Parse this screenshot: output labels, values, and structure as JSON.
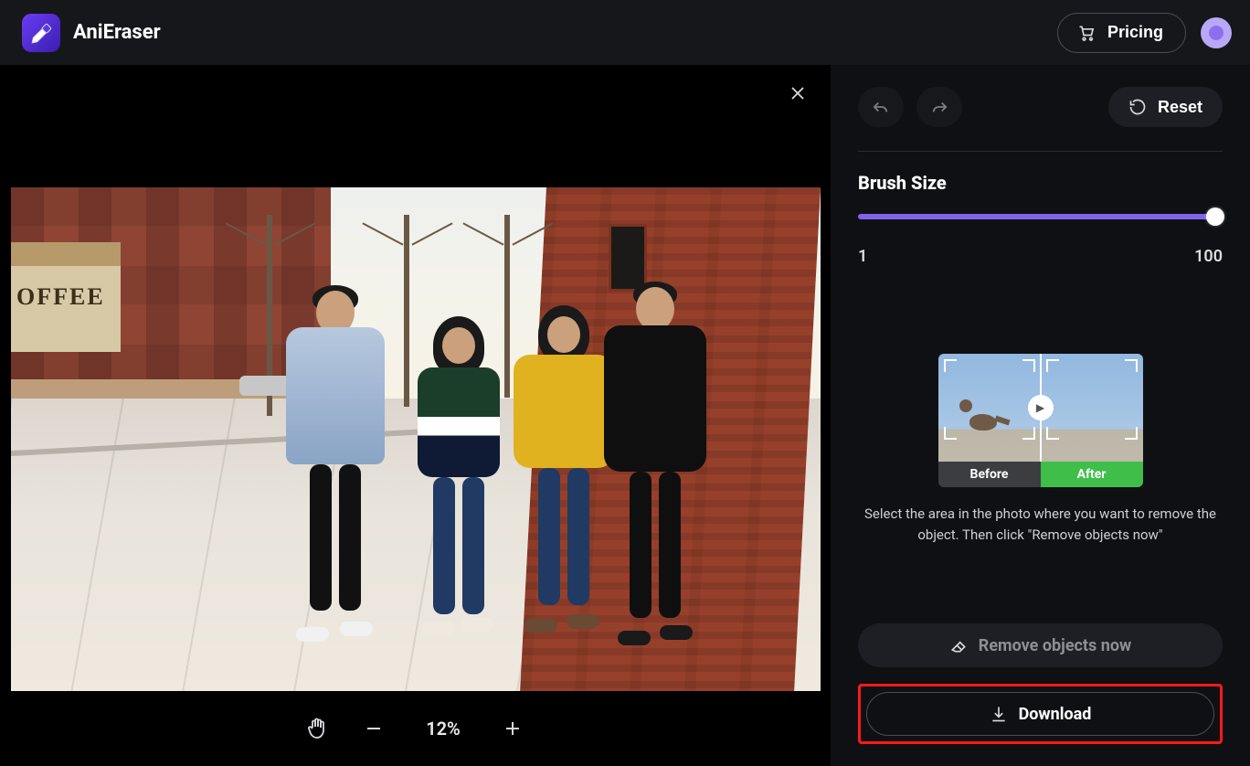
{
  "header": {
    "app_name": "AniEraser",
    "pricing_label": "Pricing"
  },
  "canvas": {
    "zoom_percent_label": "12%"
  },
  "sidebar": {
    "reset_label": "Reset",
    "brush_size": {
      "title": "Brush Size",
      "min_label": "1",
      "max_label": "100",
      "value": 100
    },
    "preview": {
      "before_label": "Before",
      "after_label": "After"
    },
    "hint_text": "Select the area in the photo where you want to remove the object. Then click \"Remove objects now\"",
    "remove_label": "Remove objects now",
    "download_label": "Download"
  },
  "photo": {
    "sign_text": "OFFEE"
  }
}
